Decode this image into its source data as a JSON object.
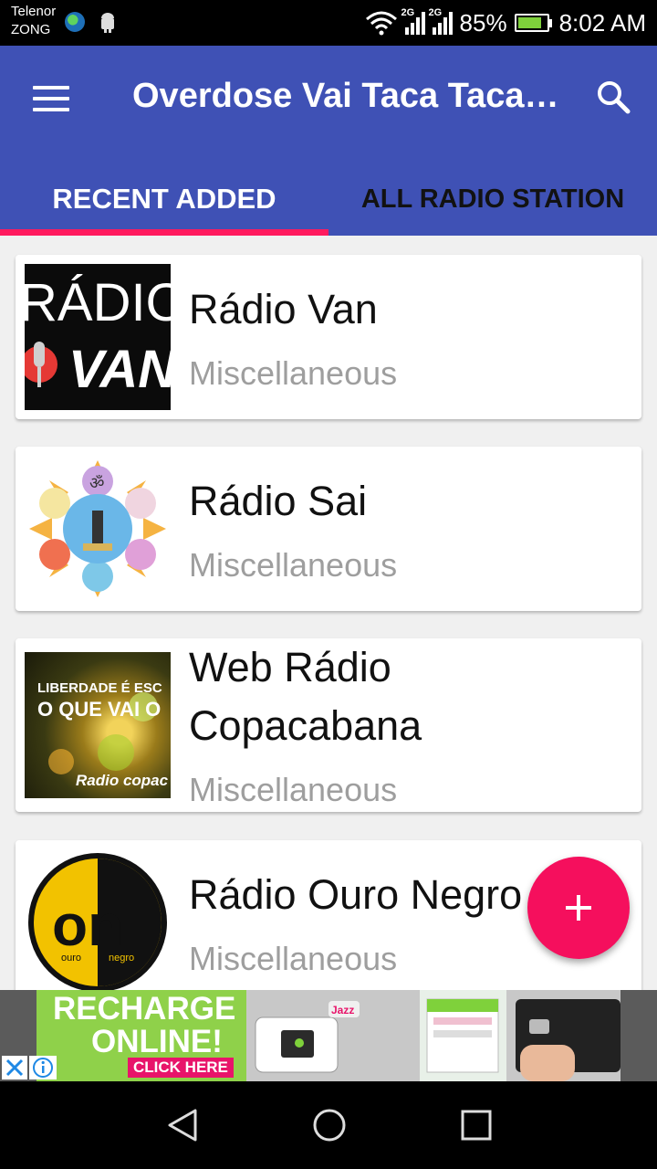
{
  "status_bar": {
    "carrier_line1": "Telenor",
    "carrier_line2": "ZONG",
    "network1": "2G",
    "network2": "2G",
    "battery": "85%",
    "battery_level": 0.85,
    "time": "8:02 AM"
  },
  "app_bar": {
    "title": "Overdose Vai Taca Taca…",
    "menu_icon": "hamburger-menu-icon",
    "search_icon": "search-icon",
    "color": "#3f51b5"
  },
  "tabs": [
    {
      "label": "RECENT ADDED",
      "active": true
    },
    {
      "label": "ALL RADIO STATION",
      "active": false
    }
  ],
  "stations": [
    {
      "name": "Rádio Van",
      "genre": "Miscellaneous",
      "logo_text": "RÁDIO",
      "logo_sub": "VAN"
    },
    {
      "name": "Rádio Sai",
      "genre": "Miscellaneous",
      "logo_text": "ॐ"
    },
    {
      "name_line1": "Web Rádio",
      "name_line2": "Copacabana",
      "genre": "Miscellaneous",
      "logo_line1": "LIBERDADE É ESC",
      "logo_line2": "O QUE VAI O",
      "logo_line3": "Radio copac"
    },
    {
      "name": "Rádio Ouro Negro",
      "genre": "Miscellaneous",
      "logo_text": "on",
      "logo_sub1": "ouro",
      "logo_sub2": "negro"
    }
  ],
  "fab": {
    "icon": "plus-icon",
    "color": "#f50f5d"
  },
  "ad": {
    "line1": "RECHARGE",
    "line2": "ONLINE!",
    "cta": "CLICK HERE",
    "brand": "Jazz"
  },
  "nav": {
    "back_icon": "back-icon",
    "home_icon": "home-icon",
    "recents_icon": "recents-icon"
  },
  "colors": {
    "accent": "#ff1a5e",
    "primary": "#3f51b5"
  }
}
